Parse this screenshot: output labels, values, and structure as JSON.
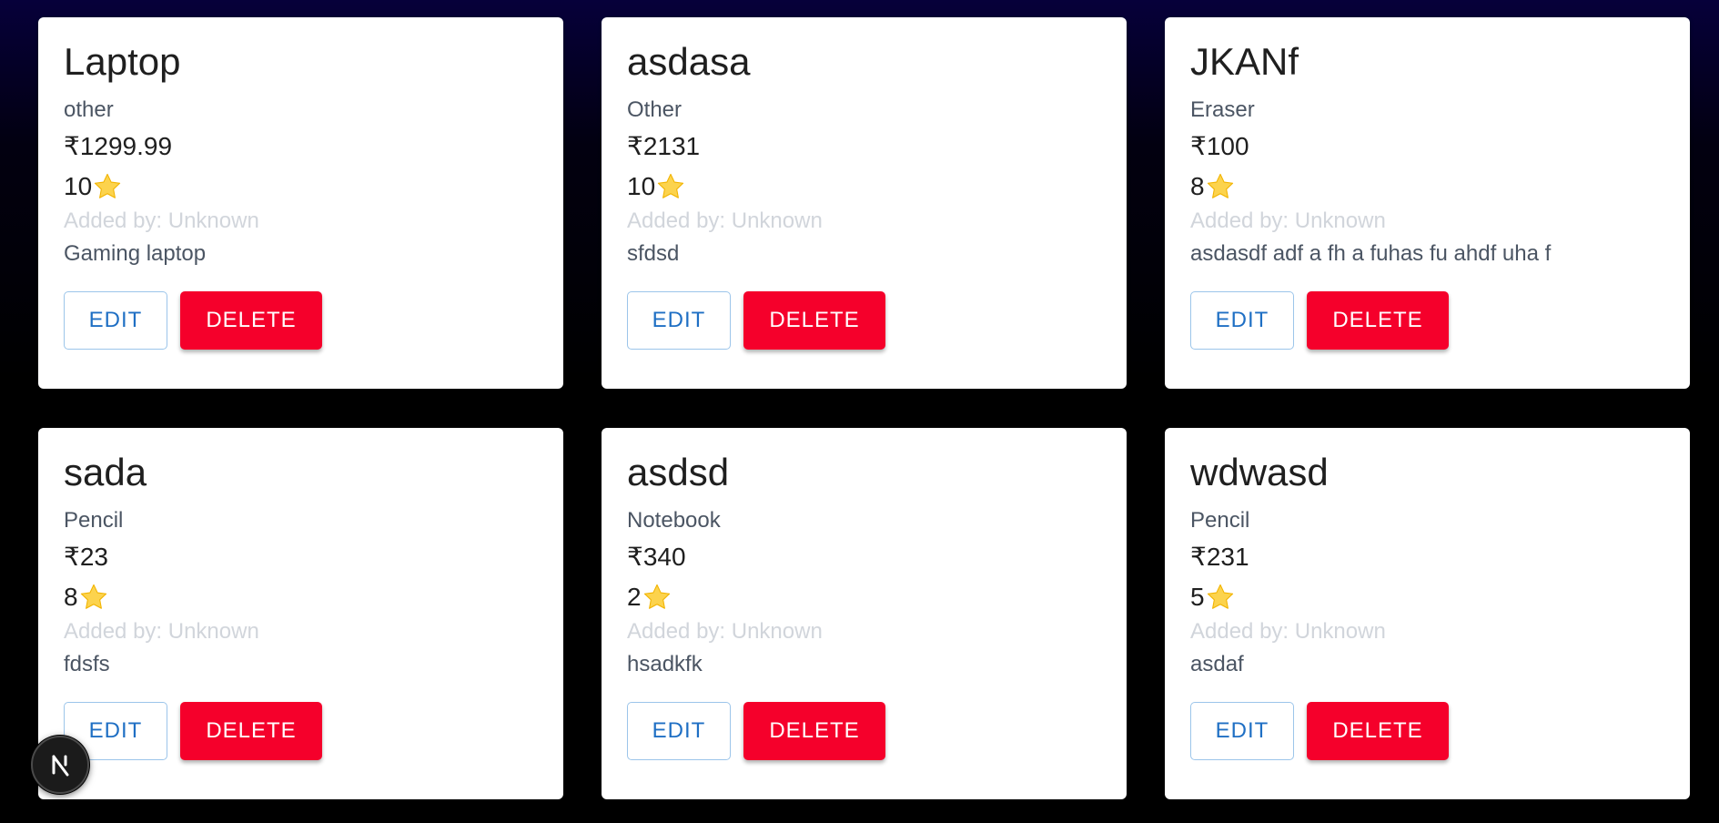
{
  "products": [
    {
      "name": "Laptop",
      "category": "other",
      "price": "₹1299.99",
      "rating": "10",
      "added_by": "Added by: Unknown",
      "description": "Gaming laptop",
      "edit_label": "EDIT",
      "delete_label": "DELETE"
    },
    {
      "name": "asdasa",
      "category": "Other",
      "price": "₹2131",
      "rating": "10",
      "added_by": "Added by: Unknown",
      "description": "sfdsd",
      "edit_label": "EDIT",
      "delete_label": "DELETE"
    },
    {
      "name": "JKANf",
      "category": "Eraser",
      "price": "₹100",
      "rating": "8",
      "added_by": "Added by: Unknown",
      "description": "asdasdf adf a fh a fuhas fu ahdf uha f",
      "edit_label": "EDIT",
      "delete_label": "DELETE"
    },
    {
      "name": "sada",
      "category": "Pencil",
      "price": "₹23",
      "rating": "8",
      "added_by": "Added by: Unknown",
      "description": "fdsfs",
      "edit_label": "EDIT",
      "delete_label": "DELETE"
    },
    {
      "name": "asdsd",
      "category": "Notebook",
      "price": "₹340",
      "rating": "2",
      "added_by": "Added by: Unknown",
      "description": "hsadkfk",
      "edit_label": "EDIT",
      "delete_label": "DELETE"
    },
    {
      "name": "wdwasd",
      "category": "Pencil",
      "price": "₹231",
      "rating": "5",
      "added_by": "Added by: Unknown",
      "description": "asdaf",
      "edit_label": "EDIT",
      "delete_label": "DELETE"
    }
  ],
  "icons": {
    "rating": "star-icon",
    "dev_badge": "n-logo-icon"
  },
  "colors": {
    "delete_button": "#f5002b",
    "edit_text": "#1f6fc4",
    "edit_border": "#9cc5ea",
    "star": "#fcd34d"
  }
}
